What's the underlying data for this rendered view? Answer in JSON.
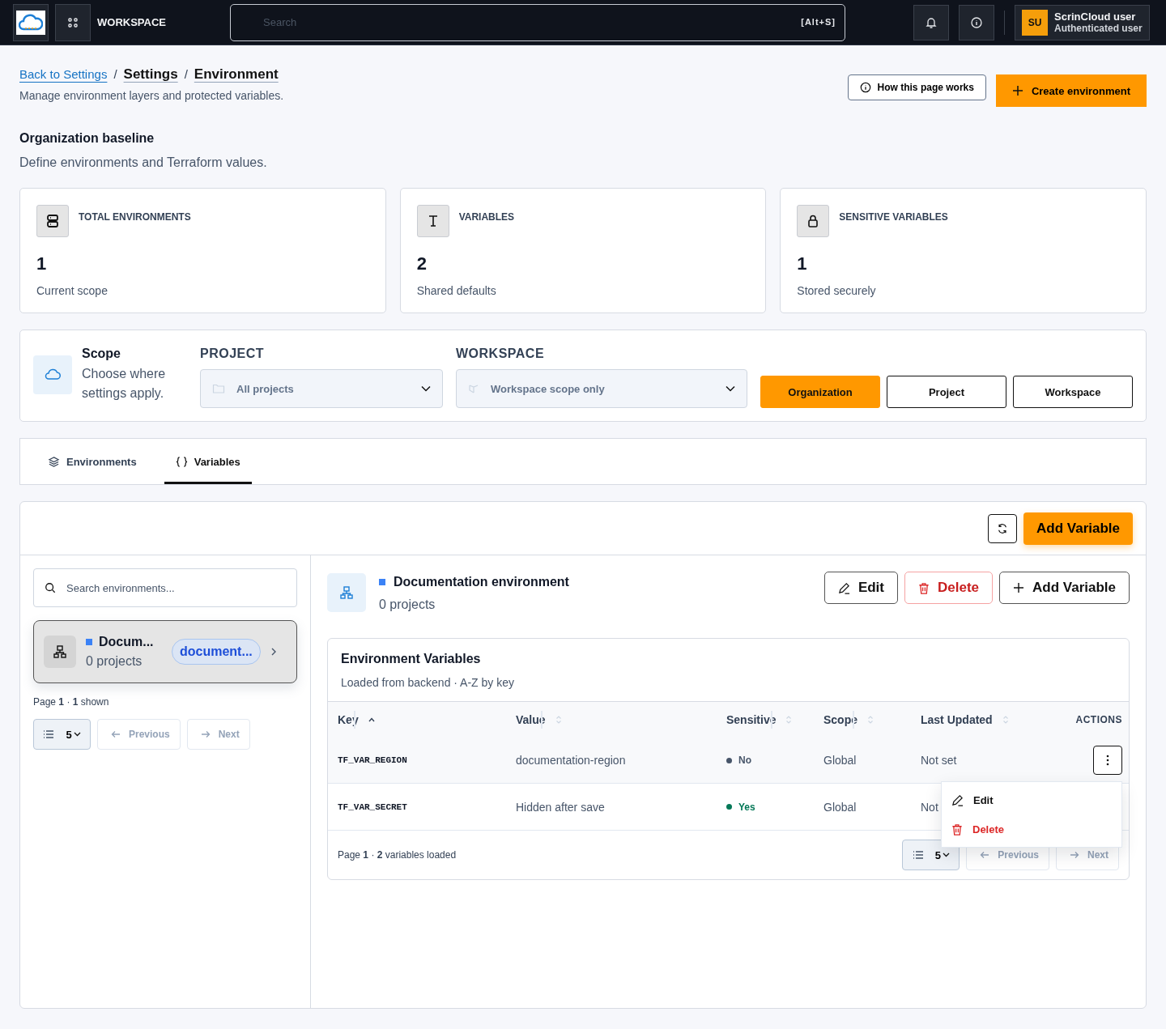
{
  "topbar": {
    "workspace": "WORKSPACE",
    "search": {
      "placeholder": "Search",
      "shortcut": "[Alt+S]"
    },
    "user": {
      "initials": "SU",
      "name": "ScrinCloud user",
      "role": "Authenticated user"
    }
  },
  "breadcrumb": [
    {
      "label": "Back to Settings",
      "kind": "link"
    },
    {
      "separator": "/",
      "label": "Settings",
      "kind": "page"
    },
    {
      "separator": "/",
      "label": "Environment",
      "kind": "page"
    }
  ],
  "page_subtitle": "Manage environment layers and protected variables.",
  "header_buttons": {
    "help": "How this page works",
    "create": "Create environment"
  },
  "section": {
    "title": "Organization baseline",
    "subtitle": "Define environments and Terraform values."
  },
  "stats": [
    {
      "kind": "servers",
      "label": "TOTAL ENVIRONMENTS",
      "value": "1",
      "note": "Current scope"
    },
    {
      "kind": "text",
      "label": "VARIABLES",
      "value": "2",
      "note": "Shared defaults"
    },
    {
      "kind": "lock",
      "label": "SENSITIVE VARIABLES",
      "value": "1",
      "note": "Stored securely"
    }
  ],
  "scope": {
    "title": "Scope",
    "description": "Choose where settings apply.",
    "project": {
      "label": "PROJECT",
      "value": "All projects"
    },
    "workspace": {
      "label": "WORKSPACE",
      "value": "Workspace scope only"
    },
    "levels": [
      {
        "label": "Organization",
        "selected": true
      },
      {
        "label": "Project",
        "selected": false
      },
      {
        "label": "Workspace",
        "selected": false
      }
    ]
  },
  "tabs": [
    {
      "kind": "layers",
      "label": "Environments",
      "selected": false
    },
    {
      "kind": "braces",
      "label": "Variables",
      "selected": true
    }
  ],
  "toolbar": {
    "add": "Add Variable"
  },
  "env_list": {
    "search_placeholder": "Search environments...",
    "items": [
      {
        "name": "Docum...",
        "projects": "0 projects",
        "tag": "document...",
        "color": "#3b82f6",
        "selected": true
      }
    ],
    "pagination": {
      "info": "Page **1** · **1** shown",
      "page_size": "5",
      "previous": "Previous",
      "next": "Next"
    }
  },
  "detail": {
    "name": "Documentation environment",
    "color": "#3b82f6",
    "projects": "0 projects",
    "buttons": {
      "edit": "Edit",
      "delete": "Delete",
      "add": "Add Variable"
    }
  },
  "variables_table": {
    "title": "Environment Variables",
    "subtitle": "Loaded from backend · A-Z by key",
    "columns": [
      {
        "label": "Key",
        "kind": "sort",
        "sorted": true
      },
      {
        "label": "Value",
        "kind": "sort",
        "sorted": false
      },
      {
        "label": "Sensitive",
        "kind": "sort",
        "sorted": false
      },
      {
        "label": "Scope",
        "kind": "sort",
        "sorted": false
      },
      {
        "label": "Last Updated",
        "kind": "sort",
        "sorted": false
      },
      {
        "label": "ACTIONS",
        "kind": "actions"
      }
    ],
    "rows": [
      {
        "key": "TF_VAR_REGION",
        "value": "documentation-region",
        "sensitive": false,
        "sensitive_label": "No",
        "scope": "Global",
        "updated": "Not set",
        "menu_open": true
      },
      {
        "key": "TF_VAR_SECRET",
        "value": "Hidden after save",
        "sensitive": true,
        "sensitive_label": "Yes",
        "scope": "Global",
        "updated": "Not",
        "menu_open": false
      }
    ],
    "footer": {
      "info": "Page **1** · **2** variables loaded",
      "page_size": "5",
      "previous": "Previous",
      "next": "Next"
    },
    "menu": [
      {
        "kind": "edit",
        "label": "Edit"
      },
      {
        "kind": "danger",
        "label": "Delete"
      }
    ]
  }
}
